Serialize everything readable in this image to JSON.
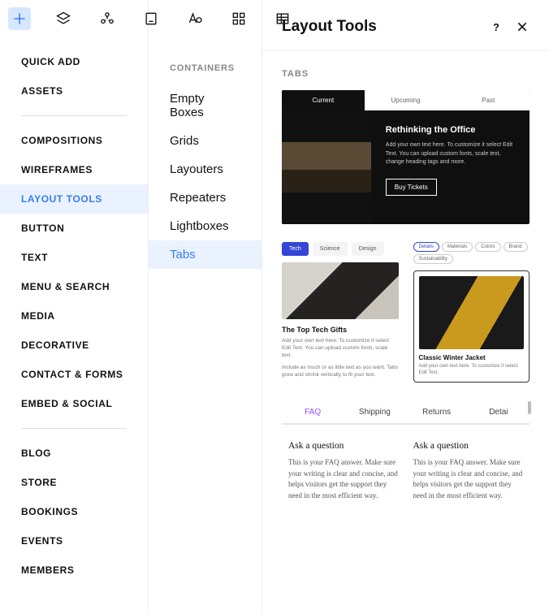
{
  "toolbar_icons": [
    "plus-icon",
    "layers-icon",
    "components-icon",
    "page-icon",
    "text-style-icon",
    "grid-icon",
    "table-icon"
  ],
  "sidebar": {
    "groups": [
      [
        "QUICK ADD",
        "ASSETS"
      ],
      [
        "COMPOSITIONS",
        "WIREFRAMES",
        "LAYOUT TOOLS",
        "BUTTON",
        "TEXT",
        "MENU & SEARCH",
        "MEDIA",
        "DECORATIVE",
        "CONTACT & FORMS",
        "EMBED & SOCIAL"
      ],
      [
        "BLOG",
        "STORE",
        "BOOKINGS",
        "EVENTS",
        "MEMBERS"
      ]
    ],
    "active": "LAYOUT TOOLS"
  },
  "sublist": {
    "heading": "CONTAINERS",
    "items": [
      "Empty Boxes",
      "Grids",
      "Layouters",
      "Repeaters",
      "Lightboxes",
      "Tabs"
    ],
    "active": "Tabs"
  },
  "panel": {
    "title": "Layout Tools",
    "section": "TABS"
  },
  "pv1": {
    "tabs": [
      "Current",
      "Upcoming",
      "Past"
    ],
    "heading": "Rethinking the Office",
    "body": "Add your own text here. To customize it select Edit Text. You can upload custom fonts, scale text, change heading tags and more.",
    "button": "Buy Tickets"
  },
  "pv2": {
    "tabs": [
      "Tech",
      "Science",
      "Design"
    ],
    "heading": "The Top Tech Gifts",
    "body1": "Add your own text here. To customize it select Edit Text. You can upload custom fonts, scale text.",
    "body2": "Include as much or as little text as you want. Tabs grow and shrink vertically to fit your text."
  },
  "pv3": {
    "tags": [
      "Details",
      "Materials",
      "Colors",
      "Brand",
      "Sustainability"
    ],
    "heading": "Classic Winter Jacket",
    "body": "Add your own text here. To customize it select Edit Text."
  },
  "pv4": {
    "tabs": [
      "FAQ",
      "Shipping",
      "Returns",
      "Detai"
    ],
    "faq_q": "Ask a question",
    "faq_a": "This is your FAQ answer. Make sure your writing is clear and concise, and helps visitors get the support they need in the most efficient way."
  }
}
